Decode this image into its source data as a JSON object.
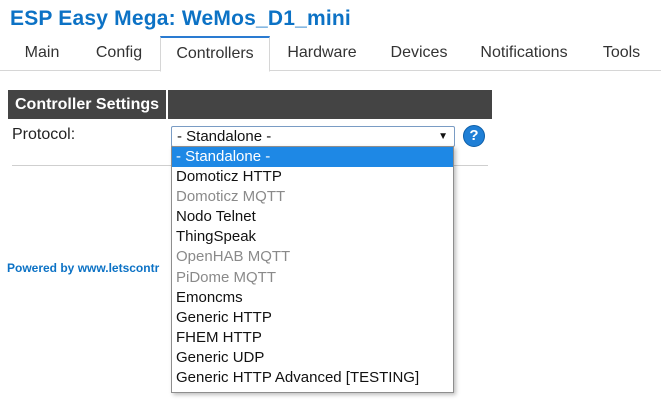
{
  "app": {
    "title": "ESP Easy Mega: WeMos_D1_mini",
    "accent_color": "#0c72c5"
  },
  "tabs": [
    {
      "label": "Main",
      "active": false
    },
    {
      "label": "Config",
      "active": false
    },
    {
      "label": "Controllers",
      "active": true
    },
    {
      "label": "Hardware",
      "active": false
    },
    {
      "label": "Devices",
      "active": false
    },
    {
      "label": "Notifications",
      "active": false
    },
    {
      "label": "Tools",
      "active": false
    }
  ],
  "settings": {
    "header_title": "Controller Settings",
    "protocol_label": "Protocol:",
    "protocol_selected": "- Standalone -",
    "help_icon": "help-icon",
    "help_text": "?"
  },
  "dropdown": {
    "options": [
      {
        "label": "- Standalone -",
        "selected": true,
        "disabled": false
      },
      {
        "label": "Domoticz HTTP",
        "selected": false,
        "disabled": false
      },
      {
        "label": "Domoticz MQTT",
        "selected": false,
        "disabled": true
      },
      {
        "label": "Nodo Telnet",
        "selected": false,
        "disabled": false
      },
      {
        "label": "ThingSpeak",
        "selected": false,
        "disabled": false
      },
      {
        "label": "OpenHAB MQTT",
        "selected": false,
        "disabled": true
      },
      {
        "label": "PiDome MQTT",
        "selected": false,
        "disabled": true
      },
      {
        "label": "Emoncms",
        "selected": false,
        "disabled": false
      },
      {
        "label": "Generic HTTP",
        "selected": false,
        "disabled": false
      },
      {
        "label": "FHEM HTTP",
        "selected": false,
        "disabled": false
      },
      {
        "label": "Generic UDP",
        "selected": false,
        "disabled": false
      },
      {
        "label": "Generic HTTP Advanced [TESTING]",
        "selected": false,
        "disabled": false
      }
    ],
    "selected_color": "#1e88e5",
    "disabled_color": "#8a8a8a"
  },
  "footer": {
    "text": "Powered by www.letscontr"
  }
}
